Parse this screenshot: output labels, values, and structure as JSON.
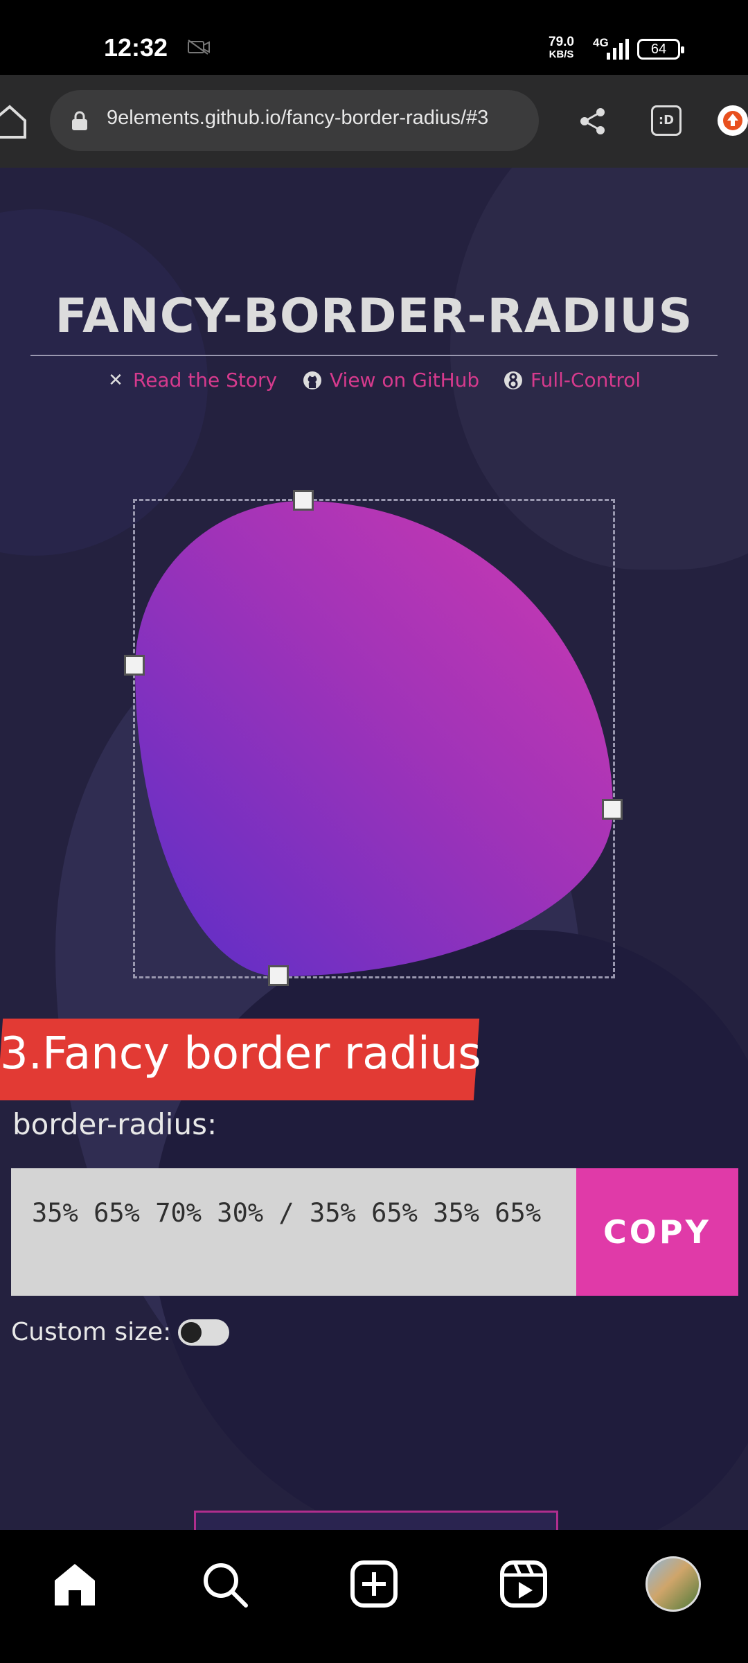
{
  "status_bar": {
    "time": "12:32",
    "speed_value": "79.0",
    "speed_unit": "KB/S",
    "network": "4G",
    "battery": "64"
  },
  "browser": {
    "url": "9elements.github.io/fancy-border-radius/#3",
    "tabs_label": ":D"
  },
  "page": {
    "title": "FANCY-BORDER-RADIUS",
    "links": [
      {
        "label": "Read the Story",
        "icon": "story-icon"
      },
      {
        "label": "View on GitHub",
        "icon": "github-icon"
      },
      {
        "label": "Full-Control",
        "icon": "full-control-icon"
      }
    ],
    "section_title": "3.Fancy border radius",
    "border_radius_label": "border-radius:",
    "border_radius_value": "35% 65% 70% 30% / 35% 65% 35% 65%",
    "copy_label": "COPY",
    "custom_size_label": "Custom size:",
    "custom_size_enabled": false
  },
  "colors": {
    "page_bg": "#24213f",
    "accent_pink": "#e03aa8",
    "banner_red": "#e23a34",
    "shape_gradient": [
      "#d03ab0",
      "#5a2ec8"
    ]
  },
  "bottom_nav": {
    "items": [
      "home-icon",
      "search-icon",
      "create-icon",
      "reels-icon",
      "profile-avatar"
    ]
  }
}
